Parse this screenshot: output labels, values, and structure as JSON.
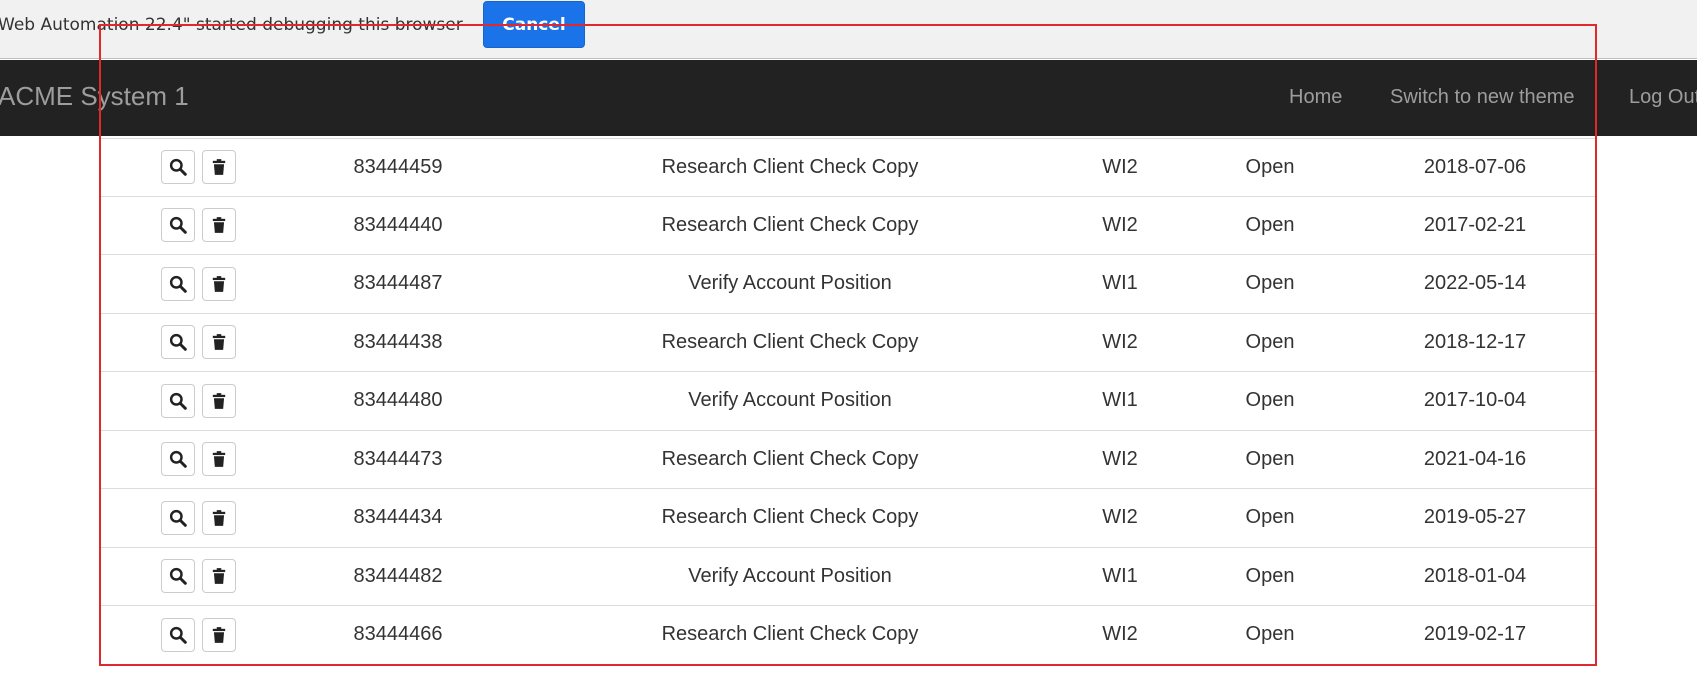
{
  "debug_bar": {
    "message": "Web Automation 22.4\" started debugging this browser",
    "cancel_label": "Cancel"
  },
  "navbar": {
    "brand": "ACME System 1",
    "links": [
      "Home",
      "Switch to new theme",
      "Log Out"
    ]
  },
  "icons": {
    "view": "search-icon",
    "delete": "trash-icon"
  },
  "colors": {
    "navbar_bg": "#222222",
    "cancel_bg": "#1a73e8",
    "highlight": "#e0282e"
  },
  "rows": [
    {
      "id": "83444459",
      "description": "Research Client Check Copy",
      "type": "WI2",
      "status": "Open",
      "date": "2018-07-06"
    },
    {
      "id": "83444440",
      "description": "Research Client Check Copy",
      "type": "WI2",
      "status": "Open",
      "date": "2017-02-21"
    },
    {
      "id": "83444487",
      "description": "Verify Account Position",
      "type": "WI1",
      "status": "Open",
      "date": "2022-05-14"
    },
    {
      "id": "83444438",
      "description": "Research Client Check Copy",
      "type": "WI2",
      "status": "Open",
      "date": "2018-12-17"
    },
    {
      "id": "83444480",
      "description": "Verify Account Position",
      "type": "WI1",
      "status": "Open",
      "date": "2017-10-04"
    },
    {
      "id": "83444473",
      "description": "Research Client Check Copy",
      "type": "WI2",
      "status": "Open",
      "date": "2021-04-16"
    },
    {
      "id": "83444434",
      "description": "Research Client Check Copy",
      "type": "WI2",
      "status": "Open",
      "date": "2019-05-27"
    },
    {
      "id": "83444482",
      "description": "Verify Account Position",
      "type": "WI1",
      "status": "Open",
      "date": "2018-01-04"
    },
    {
      "id": "83444466",
      "description": "Research Client Check Copy",
      "type": "WI2",
      "status": "Open",
      "date": "2019-02-17"
    }
  ]
}
